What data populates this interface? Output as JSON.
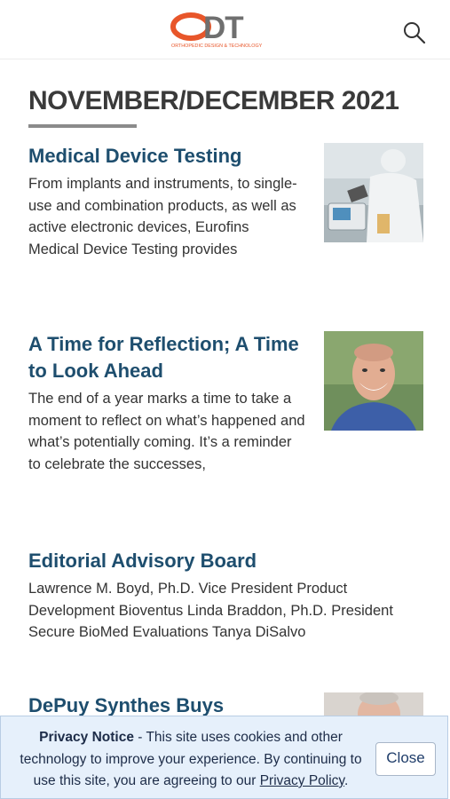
{
  "header": {
    "logo_text": "ODT",
    "logo_tagline": "ORTHOPEDIC DESIGN & TECHNOLOGY",
    "search_icon": "search-icon"
  },
  "section": {
    "title": "NOVEMBER/DECEMBER 2021"
  },
  "articles": [
    {
      "title": "Medical Device Testing",
      "excerpt": "From implants and instruments, to single-use and combination products, as well as active electronic devices, Eurofins Medical Device Testing provides",
      "image": "lab-technician-photo"
    },
    {
      "title": "A Time for Reflection; A Time to Look Ahead",
      "excerpt": "The end of a year marks a time to take a moment to reflect on what’s happened and what’s potentially coming. It’s a reminder to celebrate the successes,",
      "image": "editor-portrait-photo"
    },
    {
      "title": "Editorial Advisory Board",
      "excerpt": "Lawrence M. Boyd, Ph.D. Vice President Product Development Bioventus Linda Braddon, Ph.D. President Secure BioMed Evaluations Tanya DiSalvo"
    },
    {
      "title": "DePuy Synthes Buys",
      "image": "executive-portrait-photo"
    }
  ],
  "cookie": {
    "heading": "Privacy Notice",
    "text": " - This site uses cookies and other technology to improve your experience. By continuing to use this site, you are agreeing to our ",
    "link": "Privacy Policy",
    "end": ".",
    "close_label": "Close"
  },
  "colors": {
    "title": "#1e4e6e",
    "logo_orange": "#e8562a",
    "logo_gray": "#6f6f6f",
    "banner_bg": "#e6f0fb"
  }
}
